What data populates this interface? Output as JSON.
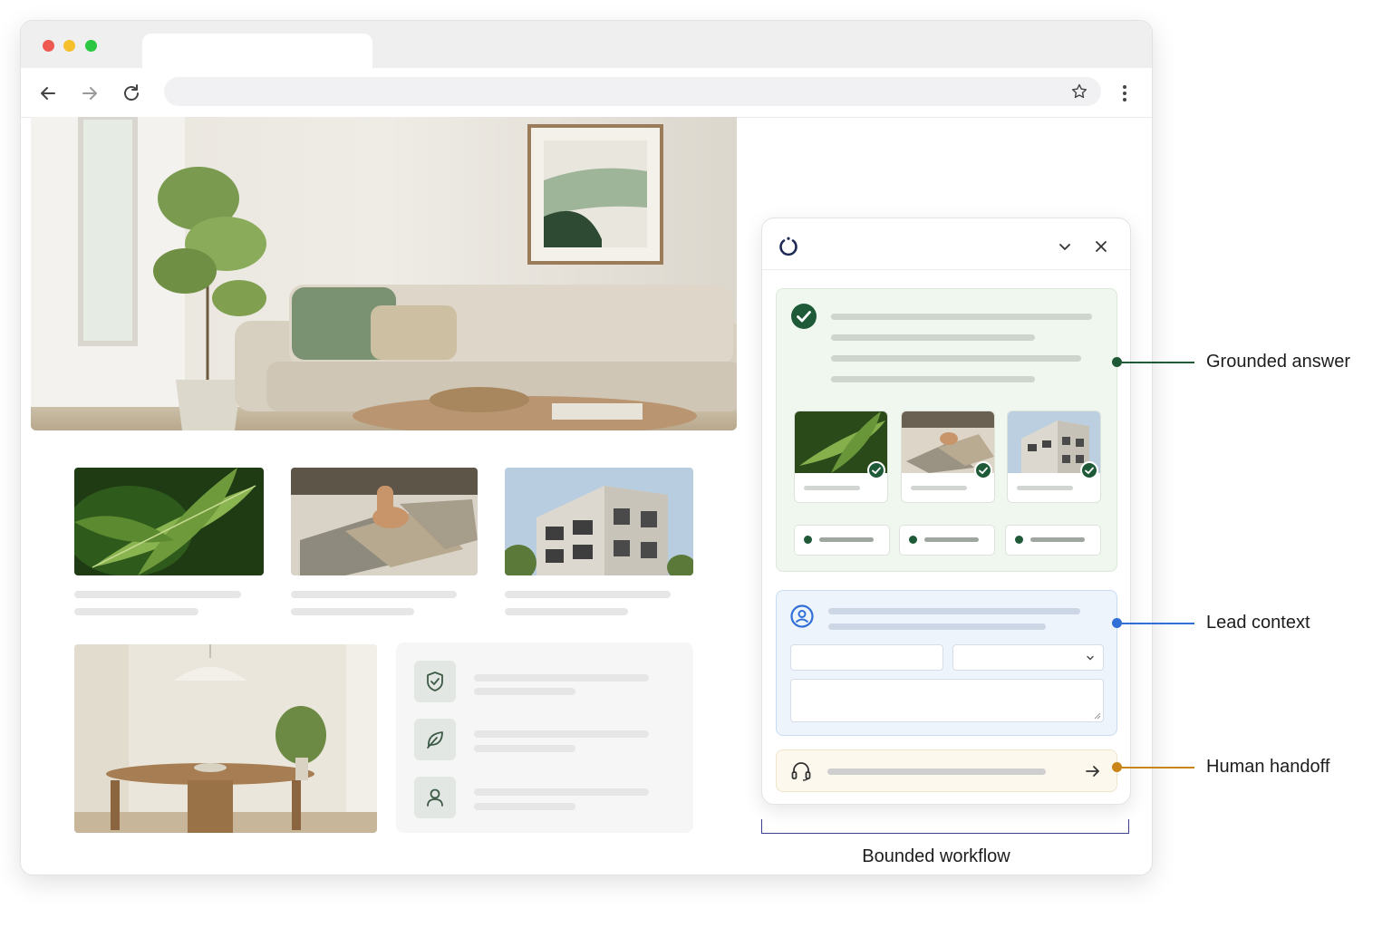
{
  "browser": {
    "traffic_lights": [
      "#ee5a52",
      "#f5bf2e",
      "#2bc742"
    ],
    "icons": [
      "back-arrow-icon",
      "forward-arrow-icon",
      "reload-icon",
      "star-icon",
      "kebab-menu-icon"
    ]
  },
  "page": {
    "hero_image": "living-room-sofa-photo",
    "cards": [
      {
        "image": "green-leaves-photo"
      },
      {
        "image": "stone-tiles-photo"
      },
      {
        "image": "apartment-building-photo"
      }
    ],
    "dining_image": "dining-room-photo",
    "features": [
      {
        "icon": "shield-icon"
      },
      {
        "icon": "leaf-icon"
      },
      {
        "icon": "person-icon"
      }
    ]
  },
  "widget": {
    "icons": [
      "loader-logo-icon",
      "chevron-down-icon",
      "close-icon",
      "check-circle-icon",
      "user-circle-icon",
      "headset-icon",
      "arrow-right-icon"
    ],
    "colors": {
      "grounded": "#1f5a38",
      "lead": "#2f6fd6",
      "handoff": "#c98518"
    }
  },
  "callouts": {
    "grounded": "Grounded answer",
    "lead": "Lead context",
    "handoff": "Human handoff",
    "workflow": "Bounded workflow"
  }
}
